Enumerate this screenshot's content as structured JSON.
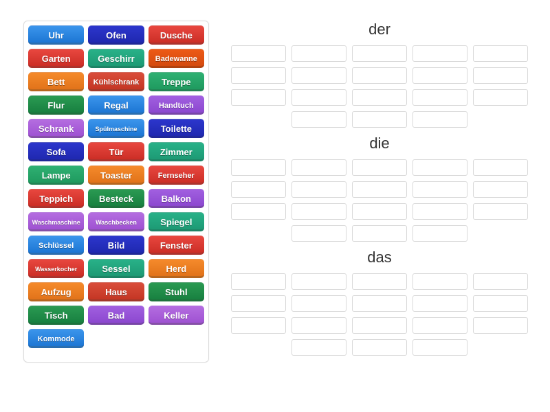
{
  "tiles": [
    {
      "label": "Uhr",
      "color": "c-blue",
      "size": ""
    },
    {
      "label": "Ofen",
      "color": "c-dblue",
      "size": ""
    },
    {
      "label": "Dusche",
      "color": "c-red",
      "size": ""
    },
    {
      "label": "Garten",
      "color": "c-red",
      "size": ""
    },
    {
      "label": "Geschirr",
      "color": "c-teal",
      "size": ""
    },
    {
      "label": "Badewanne",
      "color": "c-dorange",
      "size": "sm"
    },
    {
      "label": "Bett",
      "color": "c-orange",
      "size": ""
    },
    {
      "label": "Kühlschrank",
      "color": "c-brick",
      "size": "sm"
    },
    {
      "label": "Treppe",
      "color": "c-green",
      "size": ""
    },
    {
      "label": "Flur",
      "color": "c-dgreen",
      "size": ""
    },
    {
      "label": "Regal",
      "color": "c-blue",
      "size": ""
    },
    {
      "label": "Handtuch",
      "color": "c-purple",
      "size": "sm"
    },
    {
      "label": "Schrank",
      "color": "c-violet",
      "size": ""
    },
    {
      "label": "Spülmaschine",
      "color": "c-blue",
      "size": "xs"
    },
    {
      "label": "Toilette",
      "color": "c-dblue",
      "size": ""
    },
    {
      "label": "Sofa",
      "color": "c-dblue",
      "size": ""
    },
    {
      "label": "Tür",
      "color": "c-red",
      "size": ""
    },
    {
      "label": "Zimmer",
      "color": "c-teal",
      "size": ""
    },
    {
      "label": "Lampe",
      "color": "c-green",
      "size": ""
    },
    {
      "label": "Toaster",
      "color": "c-orange",
      "size": ""
    },
    {
      "label": "Fernseher",
      "color": "c-red",
      "size": "sm"
    },
    {
      "label": "Teppich",
      "color": "c-red",
      "size": ""
    },
    {
      "label": "Besteck",
      "color": "c-dgreen",
      "size": ""
    },
    {
      "label": "Balkon",
      "color": "c-purple",
      "size": ""
    },
    {
      "label": "Waschmaschine",
      "color": "c-violet",
      "size": "xs"
    },
    {
      "label": "Waschbecken",
      "color": "c-violet",
      "size": "xs"
    },
    {
      "label": "Spiegel",
      "color": "c-teal",
      "size": ""
    },
    {
      "label": "Schlüssel",
      "color": "c-blue",
      "size": "sm"
    },
    {
      "label": "Bild",
      "color": "c-dblue",
      "size": ""
    },
    {
      "label": "Fenster",
      "color": "c-red",
      "size": ""
    },
    {
      "label": "Wasserkocher",
      "color": "c-red",
      "size": "xs"
    },
    {
      "label": "Sessel",
      "color": "c-teal",
      "size": ""
    },
    {
      "label": "Herd",
      "color": "c-orange",
      "size": ""
    },
    {
      "label": "Aufzug",
      "color": "c-orange",
      "size": ""
    },
    {
      "label": "Haus",
      "color": "c-brick",
      "size": ""
    },
    {
      "label": "Stuhl",
      "color": "c-dgreen",
      "size": ""
    },
    {
      "label": "Tisch",
      "color": "c-dgreen",
      "size": ""
    },
    {
      "label": "Bad",
      "color": "c-purple",
      "size": ""
    },
    {
      "label": "Keller",
      "color": "c-violet",
      "size": ""
    },
    {
      "label": "Kommode",
      "color": "c-blue",
      "size": "sm"
    }
  ],
  "groups": [
    {
      "title": "der",
      "slots": 18
    },
    {
      "title": "die",
      "slots": 18
    },
    {
      "title": "das",
      "slots": 18
    }
  ]
}
